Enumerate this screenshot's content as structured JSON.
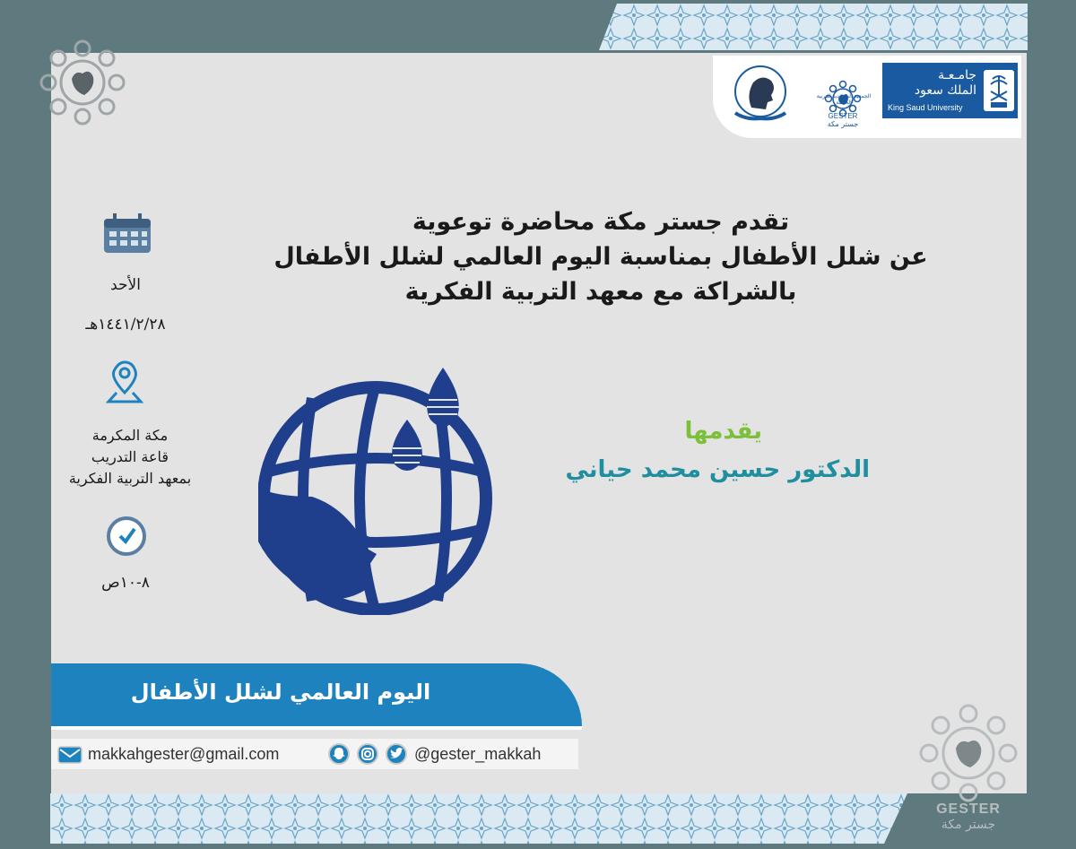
{
  "colors": {
    "frame": "#5e7a7f",
    "card": "#e3e3e4",
    "primary_blue": "#1a5aa0",
    "navy_logo": "#1f3f8c",
    "banner_blue": "#1e82bf",
    "presenter_green": "#7cbf3b",
    "presenter_teal": "#1f8fa0"
  },
  "logos": {
    "ksu_ar": "جامـعـة\nالملك سعود",
    "ksu_en": "King Saud University",
    "gester_ar": "الجمعية السعودية للتربية الخاصة",
    "gester_en": "GESTER",
    "gester_ar_short": "جستر مكة",
    "institute_icon": "head-hands-icon",
    "ksu_icon": "palm-swords-emblem-icon",
    "gester_icon": "hand-star-emblem-icon"
  },
  "headline": [
    "تقدم جستر مكة محاضرة توعوية",
    "عن شلل الأطفال بمناسبة اليوم العالمي لشلل الأطفال",
    "بالشراكة مع معهد التربية الفكرية"
  ],
  "presenter": {
    "label": "يقدمها",
    "name": "الدكتور حسين محمد حياني"
  },
  "details": {
    "calendar_icon": "calendar-icon",
    "day": "الأحد",
    "date": "١٤٤١/٢/٢٨هـ",
    "location_icon": "map-pin-icon",
    "location_lines": [
      "مكة المكرمة",
      "قاعة التدريب",
      "بمعهد التربية الفكرية"
    ],
    "clock_icon": "clock-icon",
    "time": "٨-١٠ص"
  },
  "banner": {
    "text": "اليوم العالمي لشلل الأطفال"
  },
  "contact": {
    "email": "makkahgester@gmail.com",
    "handle": "@gester_makkah",
    "icons": [
      "email-icon",
      "snapchat-icon",
      "instagram-icon",
      "twitter-icon"
    ]
  },
  "watermark": {
    "en": "GESTER",
    "ar": "جستر مكة"
  }
}
